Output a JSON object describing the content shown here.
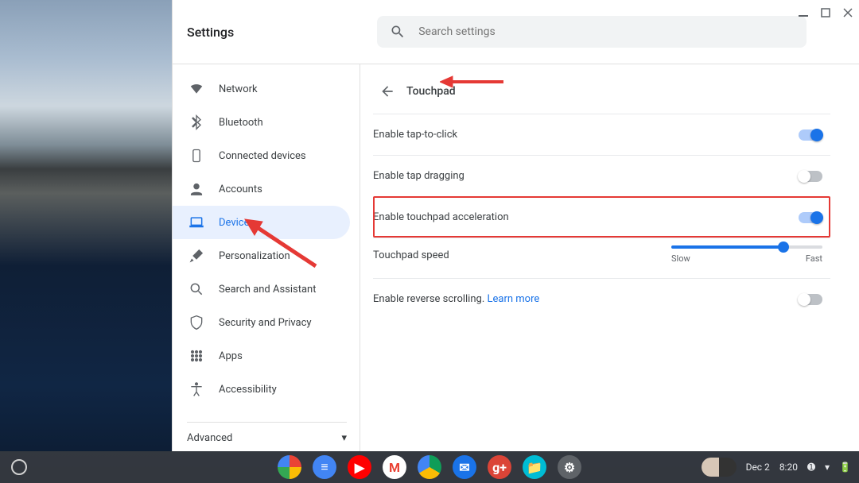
{
  "app_title": "Settings",
  "search": {
    "placeholder": "Search settings"
  },
  "sidebar": {
    "items": [
      {
        "id": "network",
        "label": "Network"
      },
      {
        "id": "bluetooth",
        "label": "Bluetooth"
      },
      {
        "id": "connected-devices",
        "label": "Connected devices"
      },
      {
        "id": "accounts",
        "label": "Accounts"
      },
      {
        "id": "device",
        "label": "Device"
      },
      {
        "id": "personalization",
        "label": "Personalization"
      },
      {
        "id": "search-assistant",
        "label": "Search and Assistant"
      },
      {
        "id": "security-privacy",
        "label": "Security and Privacy"
      },
      {
        "id": "apps",
        "label": "Apps"
      },
      {
        "id": "accessibility",
        "label": "Accessibility"
      }
    ],
    "advanced": "Advanced"
  },
  "page": {
    "title": "Touchpad",
    "options": {
      "tap_to_click": {
        "label": "Enable tap-to-click",
        "on": true
      },
      "tap_dragging": {
        "label": "Enable tap dragging",
        "on": false
      },
      "acceleration": {
        "label": "Enable touchpad acceleration",
        "on": true
      },
      "speed": {
        "label": "Touchpad speed",
        "min_label": "Slow",
        "max_label": "Fast",
        "value_pct": 74
      },
      "reverse": {
        "label": "Enable reverse scrolling. ",
        "link": "Learn more",
        "on": false
      }
    }
  },
  "shelf": {
    "date": "Dec 2",
    "time": "8:20"
  }
}
